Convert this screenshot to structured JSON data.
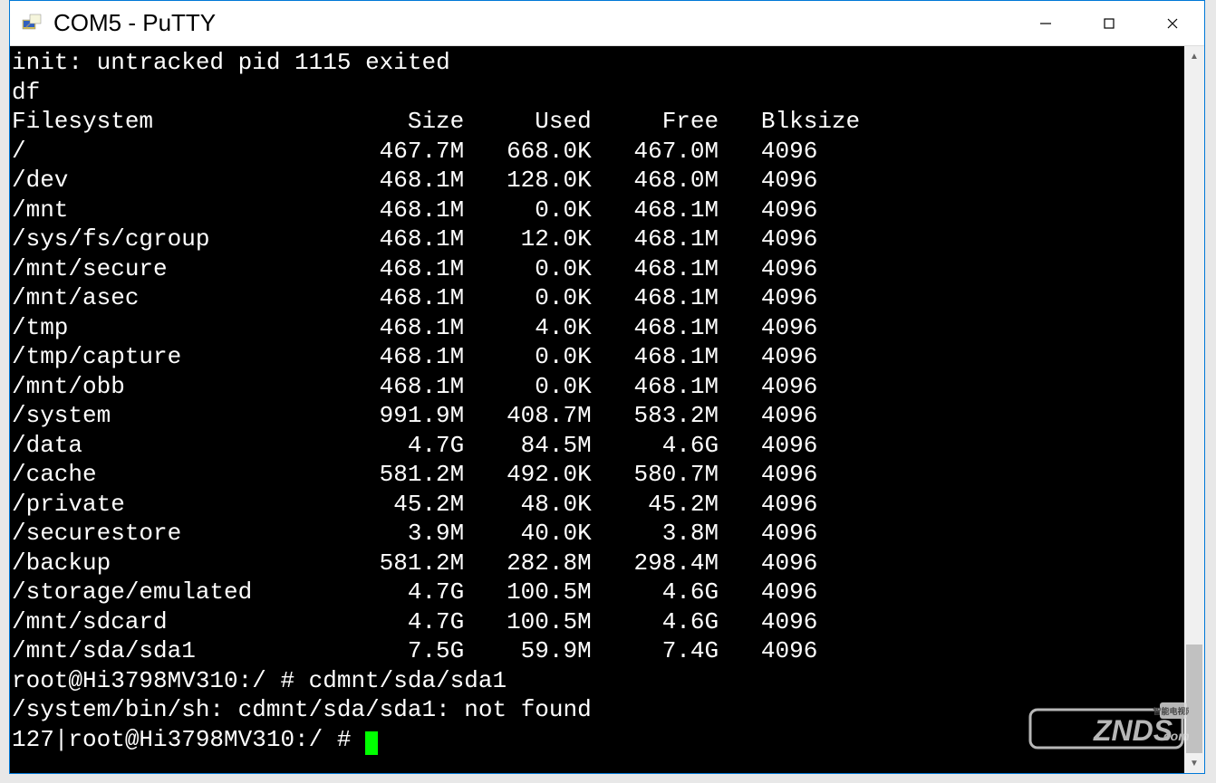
{
  "window": {
    "title": "COM5 - PuTTY"
  },
  "terminal": {
    "preamble": [
      "init: untracked pid 1115 exited",
      "df"
    ],
    "header": {
      "filesystem": "Filesystem",
      "size": "Size",
      "used": "Used",
      "free": "Free",
      "blksize": "Blksize"
    },
    "rows": [
      {
        "fs": "/",
        "size": "467.7M",
        "used": "668.0K",
        "free": "467.0M",
        "blk": "4096"
      },
      {
        "fs": "/dev",
        "size": "468.1M",
        "used": "128.0K",
        "free": "468.0M",
        "blk": "4096"
      },
      {
        "fs": "/mnt",
        "size": "468.1M",
        "used": "0.0K",
        "free": "468.1M",
        "blk": "4096"
      },
      {
        "fs": "/sys/fs/cgroup",
        "size": "468.1M",
        "used": "12.0K",
        "free": "468.1M",
        "blk": "4096"
      },
      {
        "fs": "/mnt/secure",
        "size": "468.1M",
        "used": "0.0K",
        "free": "468.1M",
        "blk": "4096"
      },
      {
        "fs": "/mnt/asec",
        "size": "468.1M",
        "used": "0.0K",
        "free": "468.1M",
        "blk": "4096"
      },
      {
        "fs": "/tmp",
        "size": "468.1M",
        "used": "4.0K",
        "free": "468.1M",
        "blk": "4096"
      },
      {
        "fs": "/tmp/capture",
        "size": "468.1M",
        "used": "0.0K",
        "free": "468.1M",
        "blk": "4096"
      },
      {
        "fs": "/mnt/obb",
        "size": "468.1M",
        "used": "0.0K",
        "free": "468.1M",
        "blk": "4096"
      },
      {
        "fs": "/system",
        "size": "991.9M",
        "used": "408.7M",
        "free": "583.2M",
        "blk": "4096"
      },
      {
        "fs": "/data",
        "size": "4.7G",
        "used": "84.5M",
        "free": "4.6G",
        "blk": "4096"
      },
      {
        "fs": "/cache",
        "size": "581.2M",
        "used": "492.0K",
        "free": "580.7M",
        "blk": "4096"
      },
      {
        "fs": "/private",
        "size": "45.2M",
        "used": "48.0K",
        "free": "45.2M",
        "blk": "4096"
      },
      {
        "fs": "/securestore",
        "size": "3.9M",
        "used": "40.0K",
        "free": "3.8M",
        "blk": "4096"
      },
      {
        "fs": "/backup",
        "size": "581.2M",
        "used": "282.8M",
        "free": "298.4M",
        "blk": "4096"
      },
      {
        "fs": "/storage/emulated",
        "size": "4.7G",
        "used": "100.5M",
        "free": "4.6G",
        "blk": "4096"
      },
      {
        "fs": "/mnt/sdcard",
        "size": "4.7G",
        "used": "100.5M",
        "free": "4.6G",
        "blk": "4096"
      },
      {
        "fs": "/mnt/sda/sda1",
        "size": "7.5G",
        "used": "59.9M",
        "free": "7.4G",
        "blk": "4096"
      }
    ],
    "postlines": [
      "root@Hi3798MV310:/ # cdmnt/sda/sda1",
      "/system/bin/sh: cdmnt/sda/sda1: not found"
    ],
    "prompt": "127|root@Hi3798MV310:/ # "
  },
  "watermark": {
    "text_top": "智能电视网",
    "text_main": "ZNDS",
    "text_suffix": ".com"
  }
}
